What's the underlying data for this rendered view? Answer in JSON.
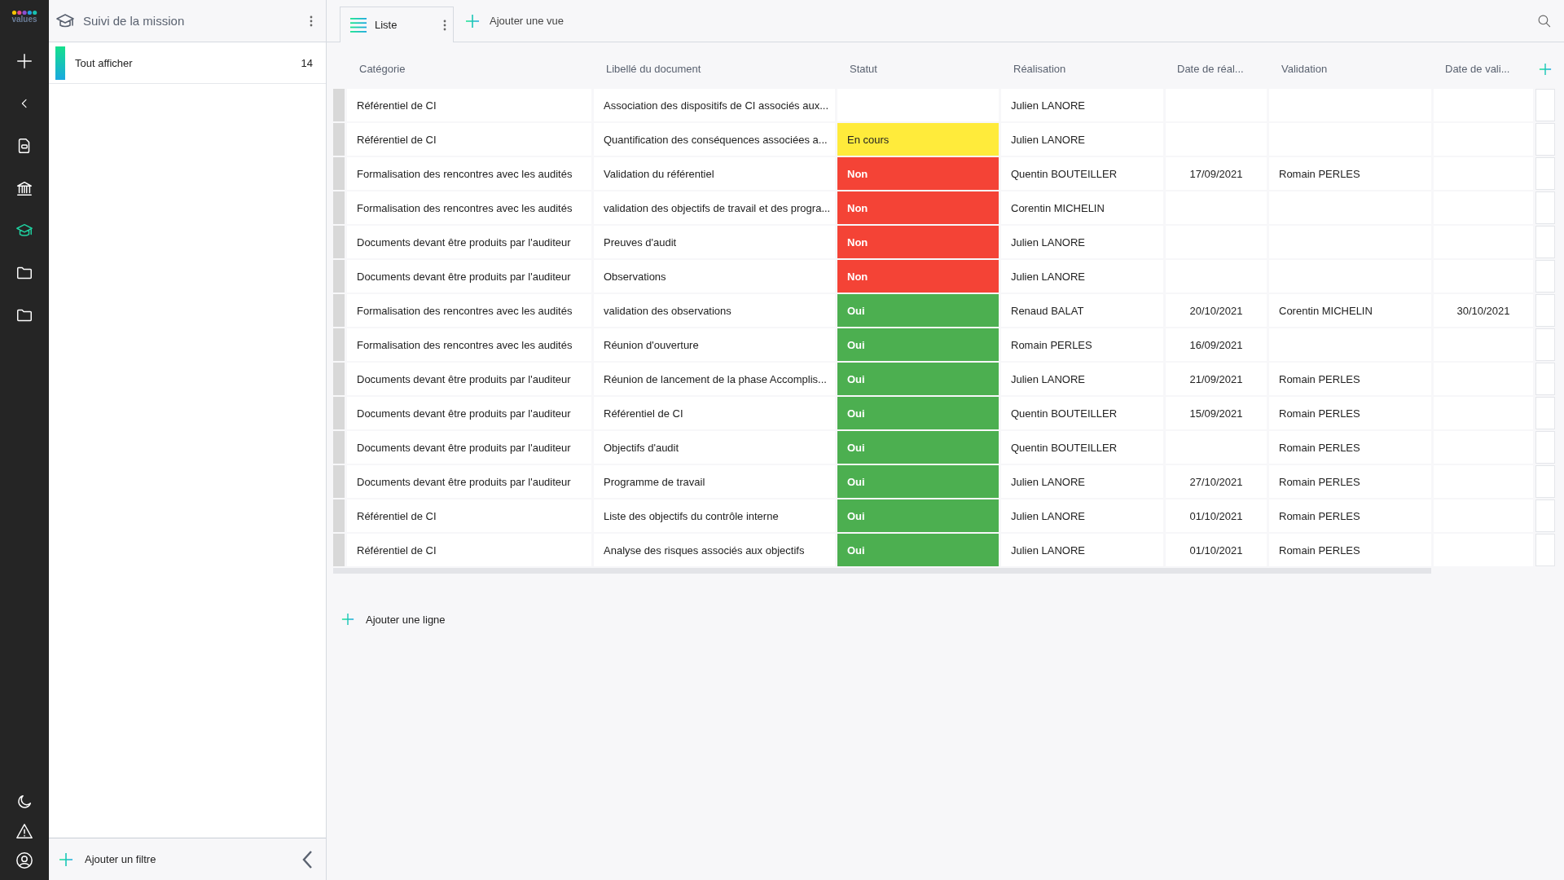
{
  "logo": "values",
  "rail": {
    "items": [
      {
        "kind": "plus",
        "selected": false
      },
      {
        "kind": "back",
        "selected": false
      },
      {
        "kind": "document",
        "selected": false
      },
      {
        "kind": "bank",
        "selected": false
      },
      {
        "kind": "mission",
        "selected": true
      },
      {
        "kind": "folder",
        "selected": false
      },
      {
        "kind": "folder",
        "selected": false
      }
    ],
    "bottom": [
      {
        "kind": "moon"
      },
      {
        "kind": "warning"
      },
      {
        "kind": "user"
      }
    ]
  },
  "panel": {
    "title": "Suivi de la mission",
    "filters": [
      {
        "label": "Tout afficher",
        "count": "14",
        "selected": true
      }
    ],
    "add_filter": "Ajouter un filtre"
  },
  "views": {
    "tabs": [
      {
        "label": "Liste",
        "selected": true
      }
    ],
    "add_view": "Ajouter une vue"
  },
  "table": {
    "columns": [
      "Catégorie",
      "Libellé du document",
      "Statut",
      "Réalisation",
      "Date de réal...",
      "Validation",
      "Date de vali..."
    ],
    "rows": [
      {
        "category": "Référentiel de CI",
        "label": "Association des dispositifs de CI associés aux...",
        "realisation": "Julien LANORE"
      },
      {
        "category": "Référentiel de CI",
        "label": "Quantification des conséquences associées a...",
        "status": {
          "text": "En cours",
          "color": "#ffeb3b"
        },
        "realisation": "Julien LANORE"
      },
      {
        "category": "Formalisation des rencontres avec les audités",
        "label": "Validation du référentiel",
        "status": {
          "text": "Non",
          "color": "#f44336"
        },
        "realisation": "Quentin BOUTEILLER",
        "date_realisation": "17/09/2021",
        "validation": "Romain PERLES"
      },
      {
        "category": "Formalisation des rencontres avec les audités",
        "label": "validation des objectifs de travail et des progra...",
        "status": {
          "text": "Non",
          "color": "#f44336"
        },
        "realisation": "Corentin MICHELIN"
      },
      {
        "category": "Documents devant être produits par l'auditeur",
        "label": "Preuves d'audit",
        "status": {
          "text": "Non",
          "color": "#f44336"
        },
        "realisation": "Julien LANORE"
      },
      {
        "category": "Documents devant être produits par l'auditeur",
        "label": "Observations",
        "status": {
          "text": "Non",
          "color": "#f44336"
        },
        "realisation": "Julien LANORE"
      },
      {
        "category": "Formalisation des rencontres avec les audités",
        "label": "validation des observations",
        "status": {
          "text": "Oui",
          "color": "#4caf50"
        },
        "realisation": "Renaud BALAT",
        "date_realisation": "20/10/2021",
        "validation": "Corentin MICHELIN",
        "date_validation": "30/10/2021"
      },
      {
        "category": "Formalisation des rencontres avec les audités",
        "label": "Réunion d'ouverture",
        "status": {
          "text": "Oui",
          "color": "#4caf50"
        },
        "realisation": "Romain PERLES",
        "date_realisation": "16/09/2021"
      },
      {
        "category": "Documents devant être produits par l'auditeur",
        "label": "Réunion de lancement de la phase Accomplis...",
        "status": {
          "text": "Oui",
          "color": "#4caf50"
        },
        "realisation": "Julien LANORE",
        "date_realisation": "21/09/2021",
        "validation": "Romain PERLES"
      },
      {
        "category": "Documents devant être produits par l'auditeur",
        "label": "Référentiel de CI",
        "status": {
          "text": "Oui",
          "color": "#4caf50"
        },
        "realisation": "Quentin BOUTEILLER",
        "date_realisation": "15/09/2021",
        "validation": "Romain PERLES"
      },
      {
        "category": "Documents devant être produits par l'auditeur",
        "label": "Objectifs d'audit",
        "status": {
          "text": "Oui",
          "color": "#4caf50"
        },
        "realisation": "Quentin BOUTEILLER",
        "validation": "Romain PERLES"
      },
      {
        "category": "Documents devant être produits par l'auditeur",
        "label": "Programme de travail",
        "status": {
          "text": "Oui",
          "color": "#4caf50"
        },
        "realisation": "Julien LANORE",
        "date_realisation": "27/10/2021",
        "validation": "Romain PERLES"
      },
      {
        "category": "Référentiel de CI",
        "label": "Liste des objectifs du contrôle interne",
        "status": {
          "text": "Oui",
          "color": "#4caf50"
        },
        "realisation": "Julien LANORE",
        "date_realisation": "01/10/2021",
        "validation": "Romain PERLES"
      },
      {
        "category": "Référentiel de CI",
        "label": "Analyse des risques associés aux objectifs",
        "status": {
          "text": "Oui",
          "color": "#4caf50"
        },
        "realisation": "Julien LANORE",
        "date_realisation": "01/10/2021",
        "validation": "Romain PERLES"
      }
    ],
    "add_row": "Ajouter une ligne"
  }
}
